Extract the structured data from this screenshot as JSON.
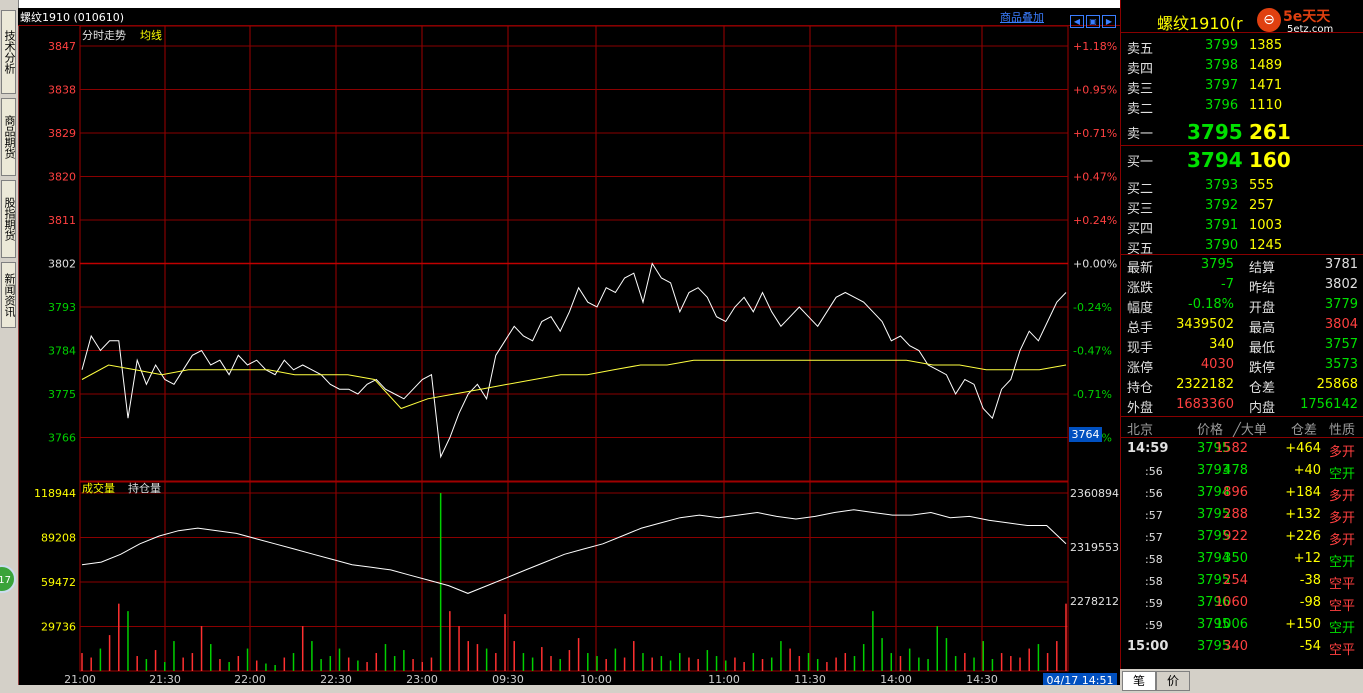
{
  "left_tabs": [
    "技术分析",
    "商品期货",
    "股指期货",
    "新闻资讯"
  ],
  "badge": "17",
  "header": {
    "title": "螺纹1910 (010610)",
    "overlay_link": "商品叠加",
    "right_name": "螺纹1910(r"
  },
  "logo": {
    "brand": "5e天天",
    "site": "5etz.com"
  },
  "chart_labels": {
    "fenshi": "分时走势",
    "junxian": "均线",
    "volume": "成交量",
    "oi": "持仓量"
  },
  "price_axis": [
    "3847",
    "3838",
    "3829",
    "3820",
    "3811",
    "3802",
    "3793",
    "3784",
    "3775",
    "3766"
  ],
  "pct_axis": [
    "+1.18%",
    "+0.95%",
    "+0.71%",
    "+0.47%",
    "+0.24%",
    "+0.00%",
    "-0.24%",
    "-0.47%",
    "-0.71%",
    "-0.95%"
  ],
  "volume_axis": [
    "118944",
    "89208",
    "59472",
    "29736"
  ],
  "oi_axis": [
    "2360894",
    "2319553",
    "2278212"
  ],
  "time_axis": [
    "21:00",
    "21:30",
    "22:00",
    "22:30",
    "23:00",
    "09:30",
    "10:00",
    "11:00",
    "11:30",
    "14:00",
    "14:30"
  ],
  "current_price_tag": "3764",
  "current_time_tag": "04/17 14:51",
  "orderbook": {
    "asks": [
      {
        "label": "卖五",
        "price": "3799",
        "vol": "1385"
      },
      {
        "label": "卖四",
        "price": "3798",
        "vol": "1489"
      },
      {
        "label": "卖三",
        "price": "3797",
        "vol": "1471"
      },
      {
        "label": "卖二",
        "price": "3796",
        "vol": "1110"
      },
      {
        "label": "卖一",
        "price": "3795",
        "vol": "261"
      }
    ],
    "bids": [
      {
        "label": "买一",
        "price": "3794",
        "vol": "160"
      },
      {
        "label": "买二",
        "price": "3793",
        "vol": "555"
      },
      {
        "label": "买三",
        "price": "3792",
        "vol": "257"
      },
      {
        "label": "买四",
        "price": "3791",
        "vol": "1003"
      },
      {
        "label": "买五",
        "price": "3790",
        "vol": "1245"
      }
    ]
  },
  "stats": [
    {
      "l1": "最新",
      "v1": "3795",
      "c1": "green",
      "l2": "结算",
      "v2": "3781",
      "c2": "wht"
    },
    {
      "l1": "涨跌",
      "v1": "-7",
      "c1": "green",
      "l2": "昨结",
      "v2": "3802",
      "c2": "wht"
    },
    {
      "l1": "幅度",
      "v1": "-0.18%",
      "c1": "green",
      "l2": "开盘",
      "v2": "3779",
      "c2": "green"
    },
    {
      "l1": "总手",
      "v1": "3439502",
      "c1": "yel",
      "l2": "最高",
      "v2": "3804",
      "c2": "red"
    },
    {
      "l1": "现手",
      "v1": "340",
      "c1": "yel",
      "l2": "最低",
      "v2": "3757",
      "c2": "green"
    },
    {
      "l1": "涨停",
      "v1": "4030",
      "c1": "red",
      "l2": "跌停",
      "v2": "3573",
      "c2": "green"
    },
    {
      "l1": "持仓",
      "v1": "2322182",
      "c1": "yel",
      "l2": "仓差",
      "v2": "25868",
      "c2": "yel"
    },
    {
      "l1": "外盘",
      "v1": "1683360",
      "c1": "red",
      "l2": "内盘",
      "v2": "1756142",
      "c2": "green"
    }
  ],
  "ticks_header": {
    "c0": "北京",
    "c1": "价格",
    "c2": "╱大单",
    "c3": "仓差",
    "c4": "性质"
  },
  "ticks": [
    {
      "t": "14:59",
      "p": "3795",
      "v": "1582",
      "vc": "red",
      "d": "+464",
      "n": "多开",
      "nc": "red"
    },
    {
      "t": ":56",
      "p": "3793",
      "v": "478",
      "vc": "green",
      "d": "+40",
      "n": "空开",
      "nc": "green"
    },
    {
      "t": ":56",
      "p": "3794",
      "v": "896",
      "vc": "red",
      "d": "+184",
      "n": "多开",
      "nc": "red"
    },
    {
      "t": ":57",
      "p": "3795",
      "v": "288",
      "vc": "red",
      "d": "+132",
      "n": "多开",
      "nc": "red"
    },
    {
      "t": ":57",
      "p": "3795",
      "v": "922",
      "vc": "red",
      "d": "+226",
      "n": "多开",
      "nc": "red"
    },
    {
      "t": ":58",
      "p": "3794",
      "v": "350",
      "vc": "green",
      "d": "+12",
      "n": "空开",
      "nc": "green"
    },
    {
      "t": ":58",
      "p": "3795",
      "v": "254",
      "vc": "red",
      "d": "-38",
      "n": "空平",
      "nc": "red"
    },
    {
      "t": ":59",
      "p": "3796",
      "v": "1060",
      "vc": "red",
      "d": "-98",
      "n": "空平",
      "nc": "red"
    },
    {
      "t": ":59",
      "p": "3795",
      "v": "1006",
      "vc": "green",
      "d": "+150",
      "n": "空开",
      "nc": "green"
    },
    {
      "t": "15:00",
      "p": "3795",
      "v": "340",
      "vc": "red",
      "d": "-54",
      "n": "空平",
      "nc": "red"
    }
  ],
  "bottom_tabs": [
    "笔",
    "价"
  ],
  "chart_data": {
    "type": "line",
    "prev_settle": 3802,
    "price_range": [
      3757,
      3847
    ],
    "price": [
      3780,
      3787,
      3784,
      3786,
      3786,
      3770,
      3782,
      3777,
      3781,
      3778,
      3777,
      3780,
      3783,
      3784,
      3781,
      3782,
      3779,
      3783,
      3781,
      3782,
      3780,
      3779,
      3782,
      3780,
      3781,
      3780,
      3779,
      3777,
      3776,
      3776,
      3775,
      3777,
      3778,
      3776,
      3775,
      3774,
      3776,
      3778,
      3779,
      3762,
      3766,
      3771,
      3775,
      3777,
      3774,
      3783,
      3786,
      3789,
      3787,
      3786,
      3790,
      3791,
      3788,
      3792,
      3797,
      3794,
      3793,
      3797,
      3796,
      3799,
      3800,
      3794,
      3802,
      3799,
      3798,
      3792,
      3796,
      3797,
      3795,
      3791,
      3790,
      3793,
      3795,
      3792,
      3796,
      3792,
      3789,
      3791,
      3793,
      3791,
      3789,
      3792,
      3795,
      3796,
      3795,
      3794,
      3792,
      3790,
      3786,
      3787,
      3785,
      3784,
      3781,
      3780,
      3779,
      3775,
      3778,
      3777,
      3772,
      3770,
      3776,
      3778,
      3784,
      3788,
      3786,
      3790,
      3794,
      3796
    ],
    "avg": [
      3778,
      3781,
      3780,
      3779,
      3780,
      3780,
      3780,
      3780,
      3779,
      3779,
      3779,
      3778,
      3772,
      3774,
      3775,
      3776,
      3777,
      3778,
      3779,
      3779,
      3780,
      3781,
      3781,
      3782,
      3782,
      3782,
      3782,
      3782,
      3782,
      3782,
      3782,
      3782,
      3781,
      3781,
      3780,
      3780,
      3780,
      3781
    ],
    "volume": [
      12000,
      9000,
      15000,
      24000,
      45000,
      40000,
      10000,
      8000,
      14000,
      6000,
      20000,
      9000,
      12000,
      30000,
      18000,
      8000,
      6000,
      10000,
      15000,
      7000,
      5000,
      4000,
      9000,
      12000,
      30000,
      20000,
      8000,
      10000,
      15000,
      9000,
      7000,
      6000,
      12000,
      18000,
      10000,
      14000,
      8000,
      6000,
      9000,
      118944,
      40000,
      30000,
      20000,
      18000,
      15000,
      12000,
      38000,
      20000,
      12000,
      9000,
      16000,
      10000,
      8000,
      14000,
      22000,
      12000,
      10000,
      8000,
      15000,
      9000,
      20000,
      12000,
      9000,
      10000,
      7000,
      12000,
      9000,
      8000,
      14000,
      10000,
      7000,
      9000,
      6000,
      12000,
      8000,
      9000,
      20000,
      15000,
      10000,
      12000,
      8000,
      6000,
      9000,
      12000,
      10000,
      18000,
      40000,
      22000,
      12000,
      10000,
      15000,
      9000,
      8000,
      30000,
      22000,
      10000,
      12000,
      9000,
      20000,
      8000,
      12000,
      10000,
      9000,
      15000,
      18000,
      12000,
      20000,
      45000
    ],
    "open_interest": [
      2306000,
      2308000,
      2314000,
      2322000,
      2328000,
      2332000,
      2334000,
      2332000,
      2330000,
      2326000,
      2322000,
      2318000,
      2314000,
      2310000,
      2306000,
      2304000,
      2302000,
      2298000,
      2294000,
      2290000,
      2284000,
      2290000,
      2296000,
      2302000,
      2308000,
      2314000,
      2318000,
      2322000,
      2328000,
      2334000,
      2338000,
      2342000,
      2344000,
      2342000,
      2344000,
      2346000,
      2343000,
      2341000,
      2343000,
      2346000,
      2348000,
      2346000,
      2344000,
      2344000,
      2346000,
      2342000,
      2343000,
      2340000,
      2338000,
      2336000,
      2336000,
      2322000
    ],
    "volume_range": [
      0,
      118944
    ],
    "oi_range": [
      2278212,
      2360894
    ],
    "grid": true
  }
}
